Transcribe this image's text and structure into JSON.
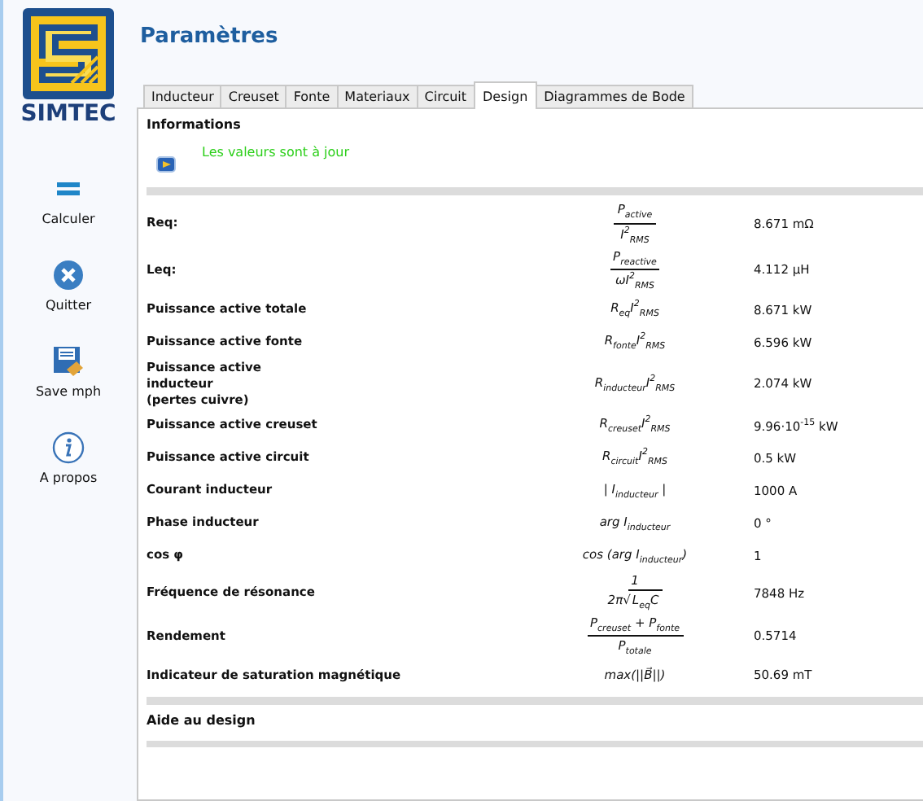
{
  "sidebar": {
    "logo_text": "SIMTEC",
    "buttons": [
      {
        "kind": "calc",
        "label": "Calculer"
      },
      {
        "kind": "quit",
        "label": "Quitter"
      },
      {
        "kind": "save",
        "label": "Save mph"
      },
      {
        "kind": "about",
        "label": "A propos"
      }
    ]
  },
  "title": "Paramètres",
  "tabs": [
    {
      "label": "Inducteur",
      "selected": false
    },
    {
      "label": "Creuset",
      "selected": false
    },
    {
      "label": "Fonte",
      "selected": false
    },
    {
      "label": "Materiaux",
      "selected": false
    },
    {
      "label": "Circuit",
      "selected": false
    },
    {
      "label": "Design",
      "selected": true
    },
    {
      "label": "Diagrammes de Bode",
      "selected": false
    }
  ],
  "informations": {
    "heading": "Informations",
    "message": "Les valeurs sont à jour"
  },
  "rows": [
    {
      "label": "Req:",
      "formula": {
        "kind": "fraction",
        "numerator": "P$_{active}$",
        "denominator": "I$^{2}$$_{RMS}$"
      },
      "value": "8.671 mΩ"
    },
    {
      "label": "Leq:",
      "formula": {
        "kind": "fraction",
        "numerator": "P$_{reactive}$",
        "denominator": "ωI$^{2}$$_{RMS}$"
      },
      "value": "4.112 µH"
    },
    {
      "label": "Puissance  active totale",
      "formula": {
        "kind": "inline",
        "text": "R$_{eq}$I$^{2}$$_{RMS}$"
      },
      "value": "8.671 kW"
    },
    {
      "label": "Puissance active fonte",
      "formula": {
        "kind": "inline",
        "text": "R$_{fonte}$I$^{2}$$_{RMS}$"
      },
      "value": "6.596 kW"
    },
    {
      "label": "Puissance active\ninducteur\n(pertes cuivre)",
      "formula": {
        "kind": "inline",
        "text": "R$_{inducteur}$I$^{2}$$_{RMS}$"
      },
      "value": "2.074 kW"
    },
    {
      "label": "Puissance active creuset",
      "formula": {
        "kind": "inline",
        "text": "R$_{creuset}$I$^{2}$$_{RMS}$"
      },
      "value": "9.96·10$^{-15}$ kW"
    },
    {
      "label": "Puissance active circuit",
      "formula": {
        "kind": "inline",
        "text": "R$_{circuit}$I$^{2}$$_{RMS}$"
      },
      "value": "0.5 kW"
    },
    {
      "label": "Courant inducteur",
      "formula": {
        "kind": "inline",
        "text": "|  I$_{inducteur}$  |"
      },
      "value": "1000 A"
    },
    {
      "label": "Phase inducteur",
      "formula": {
        "kind": "inline",
        "text": "arg  I$_{inducteur}$"
      },
      "value": "0 °"
    },
    {
      "label": "cos φ",
      "formula": {
        "kind": "inline",
        "text": "cos (arg  I$_{inducteur}$)"
      },
      "value": "1"
    },
    {
      "label": "Fréquence de résonance",
      "formula": {
        "kind": "root_fraction",
        "numerator": "1",
        "factor": "2π√",
        "radicand": "L$_{eq}$C"
      },
      "value": "7848 Hz"
    },
    {
      "label": "Rendement",
      "formula": {
        "kind": "fraction",
        "numerator": "P$_{creuset}$ + P$_{fonte}$",
        "denominator": "P$_{totale}$"
      },
      "value": "0.5714"
    },
    {
      "label": "Indicateur de saturation magnétique",
      "formula": {
        "kind": "inline",
        "text": "max(||B⃗||)"
      },
      "value": "50.69 mT"
    }
  ],
  "footer_heading": "Aide au design"
}
